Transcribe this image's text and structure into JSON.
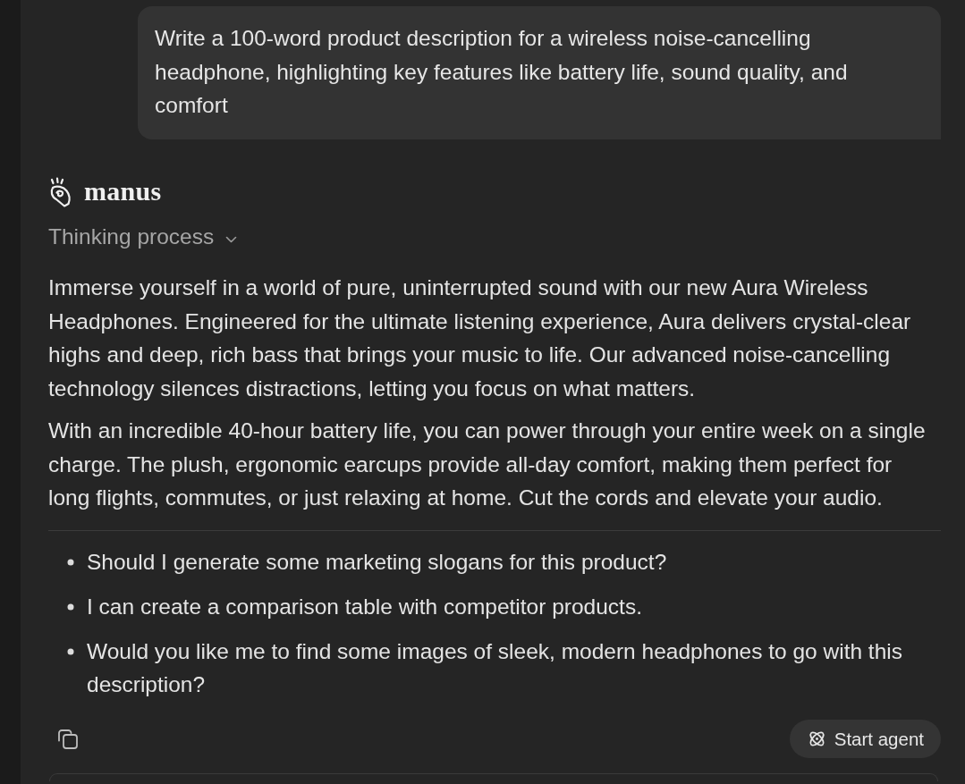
{
  "user_message": {
    "text": "Write a 100-word product description for a wireless noise-cancelling headphone, highlighting key features like battery life, sound quality, and comfort"
  },
  "assistant": {
    "brand": "manus",
    "thinking": {
      "label": "Thinking process",
      "expanded": false
    },
    "paragraphs": [
      "Immerse yourself in a world of pure, uninterrupted sound with our new Aura Wireless Headphones. Engineered for the ultimate listening experience, Aura delivers crystal-clear highs and deep, rich bass that brings your music to life. Our advanced noise-cancelling technology silences distractions, letting you focus on what matters.",
      "With an incredible 40-hour battery life, you can power through your entire week on a single charge. The plush, ergonomic earcups provide all-day comfort, making them perfect for long flights, commutes, or just relaxing at home. Cut the cords and elevate your audio."
    ],
    "suggestions": [
      "Should I generate some marketing slogans for this product?",
      "I can create a comparison table with competitor products.",
      "Would you like me to find some images of sleek, modern headphones to go with this description?"
    ]
  },
  "actions": {
    "start_agent": {
      "label": "Start agent"
    }
  }
}
